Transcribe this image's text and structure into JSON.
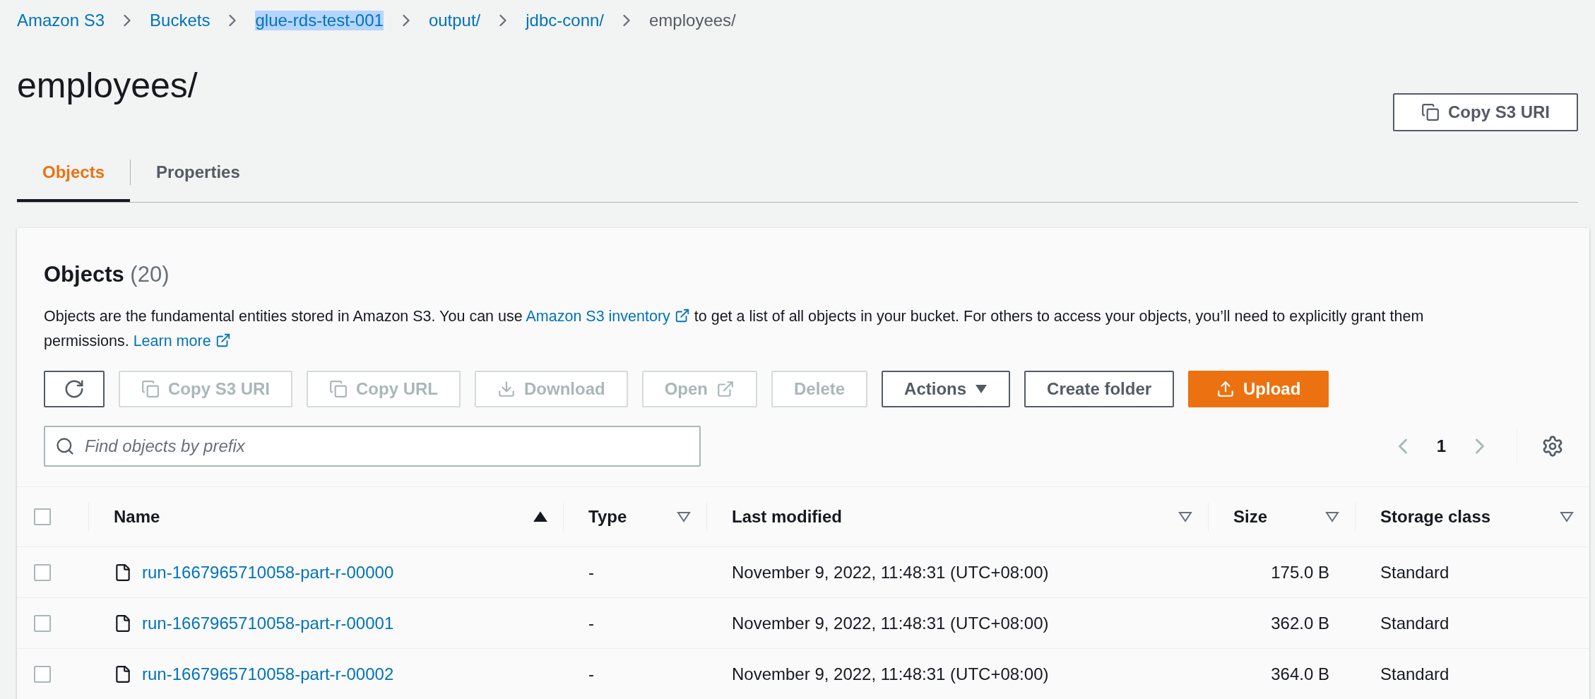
{
  "breadcrumbs": [
    {
      "label": "Amazon S3",
      "kind": "link",
      "highlighted": false
    },
    {
      "label": "Buckets",
      "kind": "link",
      "highlighted": false
    },
    {
      "label": "glue-rds-test-001",
      "kind": "link",
      "highlighted": true
    },
    {
      "label": "output/",
      "kind": "link",
      "highlighted": false
    },
    {
      "label": "jdbc-conn/",
      "kind": "link",
      "highlighted": false
    },
    {
      "label": "employees/",
      "kind": "current",
      "highlighted": false
    }
  ],
  "title": "employees/",
  "header_button": {
    "label": "Copy S3 URI"
  },
  "tabs": [
    {
      "label": "Objects",
      "selected": true
    },
    {
      "label": "Properties",
      "selected": false
    }
  ],
  "panel": {
    "title": "Objects",
    "count": "(20)",
    "description": [
      {
        "kind": "text",
        "text": "Objects are the fundamental entities stored in Amazon S3. You can use "
      },
      {
        "kind": "link",
        "text": "Amazon S3 inventory"
      },
      {
        "kind": "text",
        "text": " to get a list of all objects in your bucket. For others to access your objects, you’ll need to explicitly grant them permissions. "
      },
      {
        "kind": "link",
        "text": "Learn more"
      }
    ],
    "toolbar": [
      {
        "kind": "refresh",
        "disabled": false
      },
      {
        "kind": "copy",
        "label": "Copy S3 URI",
        "disabled": true
      },
      {
        "kind": "copy",
        "label": "Copy URL",
        "disabled": true
      },
      {
        "kind": "download",
        "label": "Download",
        "disabled": true
      },
      {
        "kind": "open",
        "label": "Open",
        "disabled": true
      },
      {
        "kind": "plain",
        "label": "Delete",
        "disabled": true
      },
      {
        "kind": "dropdown",
        "label": "Actions",
        "disabled": false
      },
      {
        "kind": "plain",
        "label": "Create folder",
        "disabled": false
      },
      {
        "kind": "upload",
        "label": "Upload",
        "disabled": false
      }
    ],
    "search": {
      "placeholder": "Find objects by prefix"
    },
    "pagination": {
      "page": "1"
    },
    "select_all_checked": false,
    "columns": [
      {
        "label": "Name",
        "sorted": true
      },
      {
        "label": "Type",
        "sorted": false
      },
      {
        "label": "Last modified",
        "sorted": false
      },
      {
        "label": "Size",
        "sorted": false
      },
      {
        "label": "Storage class",
        "sorted": false
      }
    ],
    "rows": [
      {
        "checked": false,
        "name": "run-1667965710058-part-r-00000",
        "type": "-",
        "last_modified": "November 9, 2022, 11:48:31 (UTC+08:00)",
        "size": "175.0 B",
        "storage_class": "Standard"
      },
      {
        "checked": false,
        "name": "run-1667965710058-part-r-00001",
        "type": "-",
        "last_modified": "November 9, 2022, 11:48:31 (UTC+08:00)",
        "size": "362.0 B",
        "storage_class": "Standard"
      },
      {
        "checked": false,
        "name": "run-1667965710058-part-r-00002",
        "type": "-",
        "last_modified": "November 9, 2022, 11:48:31 (UTC+08:00)",
        "size": "364.0 B",
        "storage_class": "Standard"
      }
    ]
  }
}
